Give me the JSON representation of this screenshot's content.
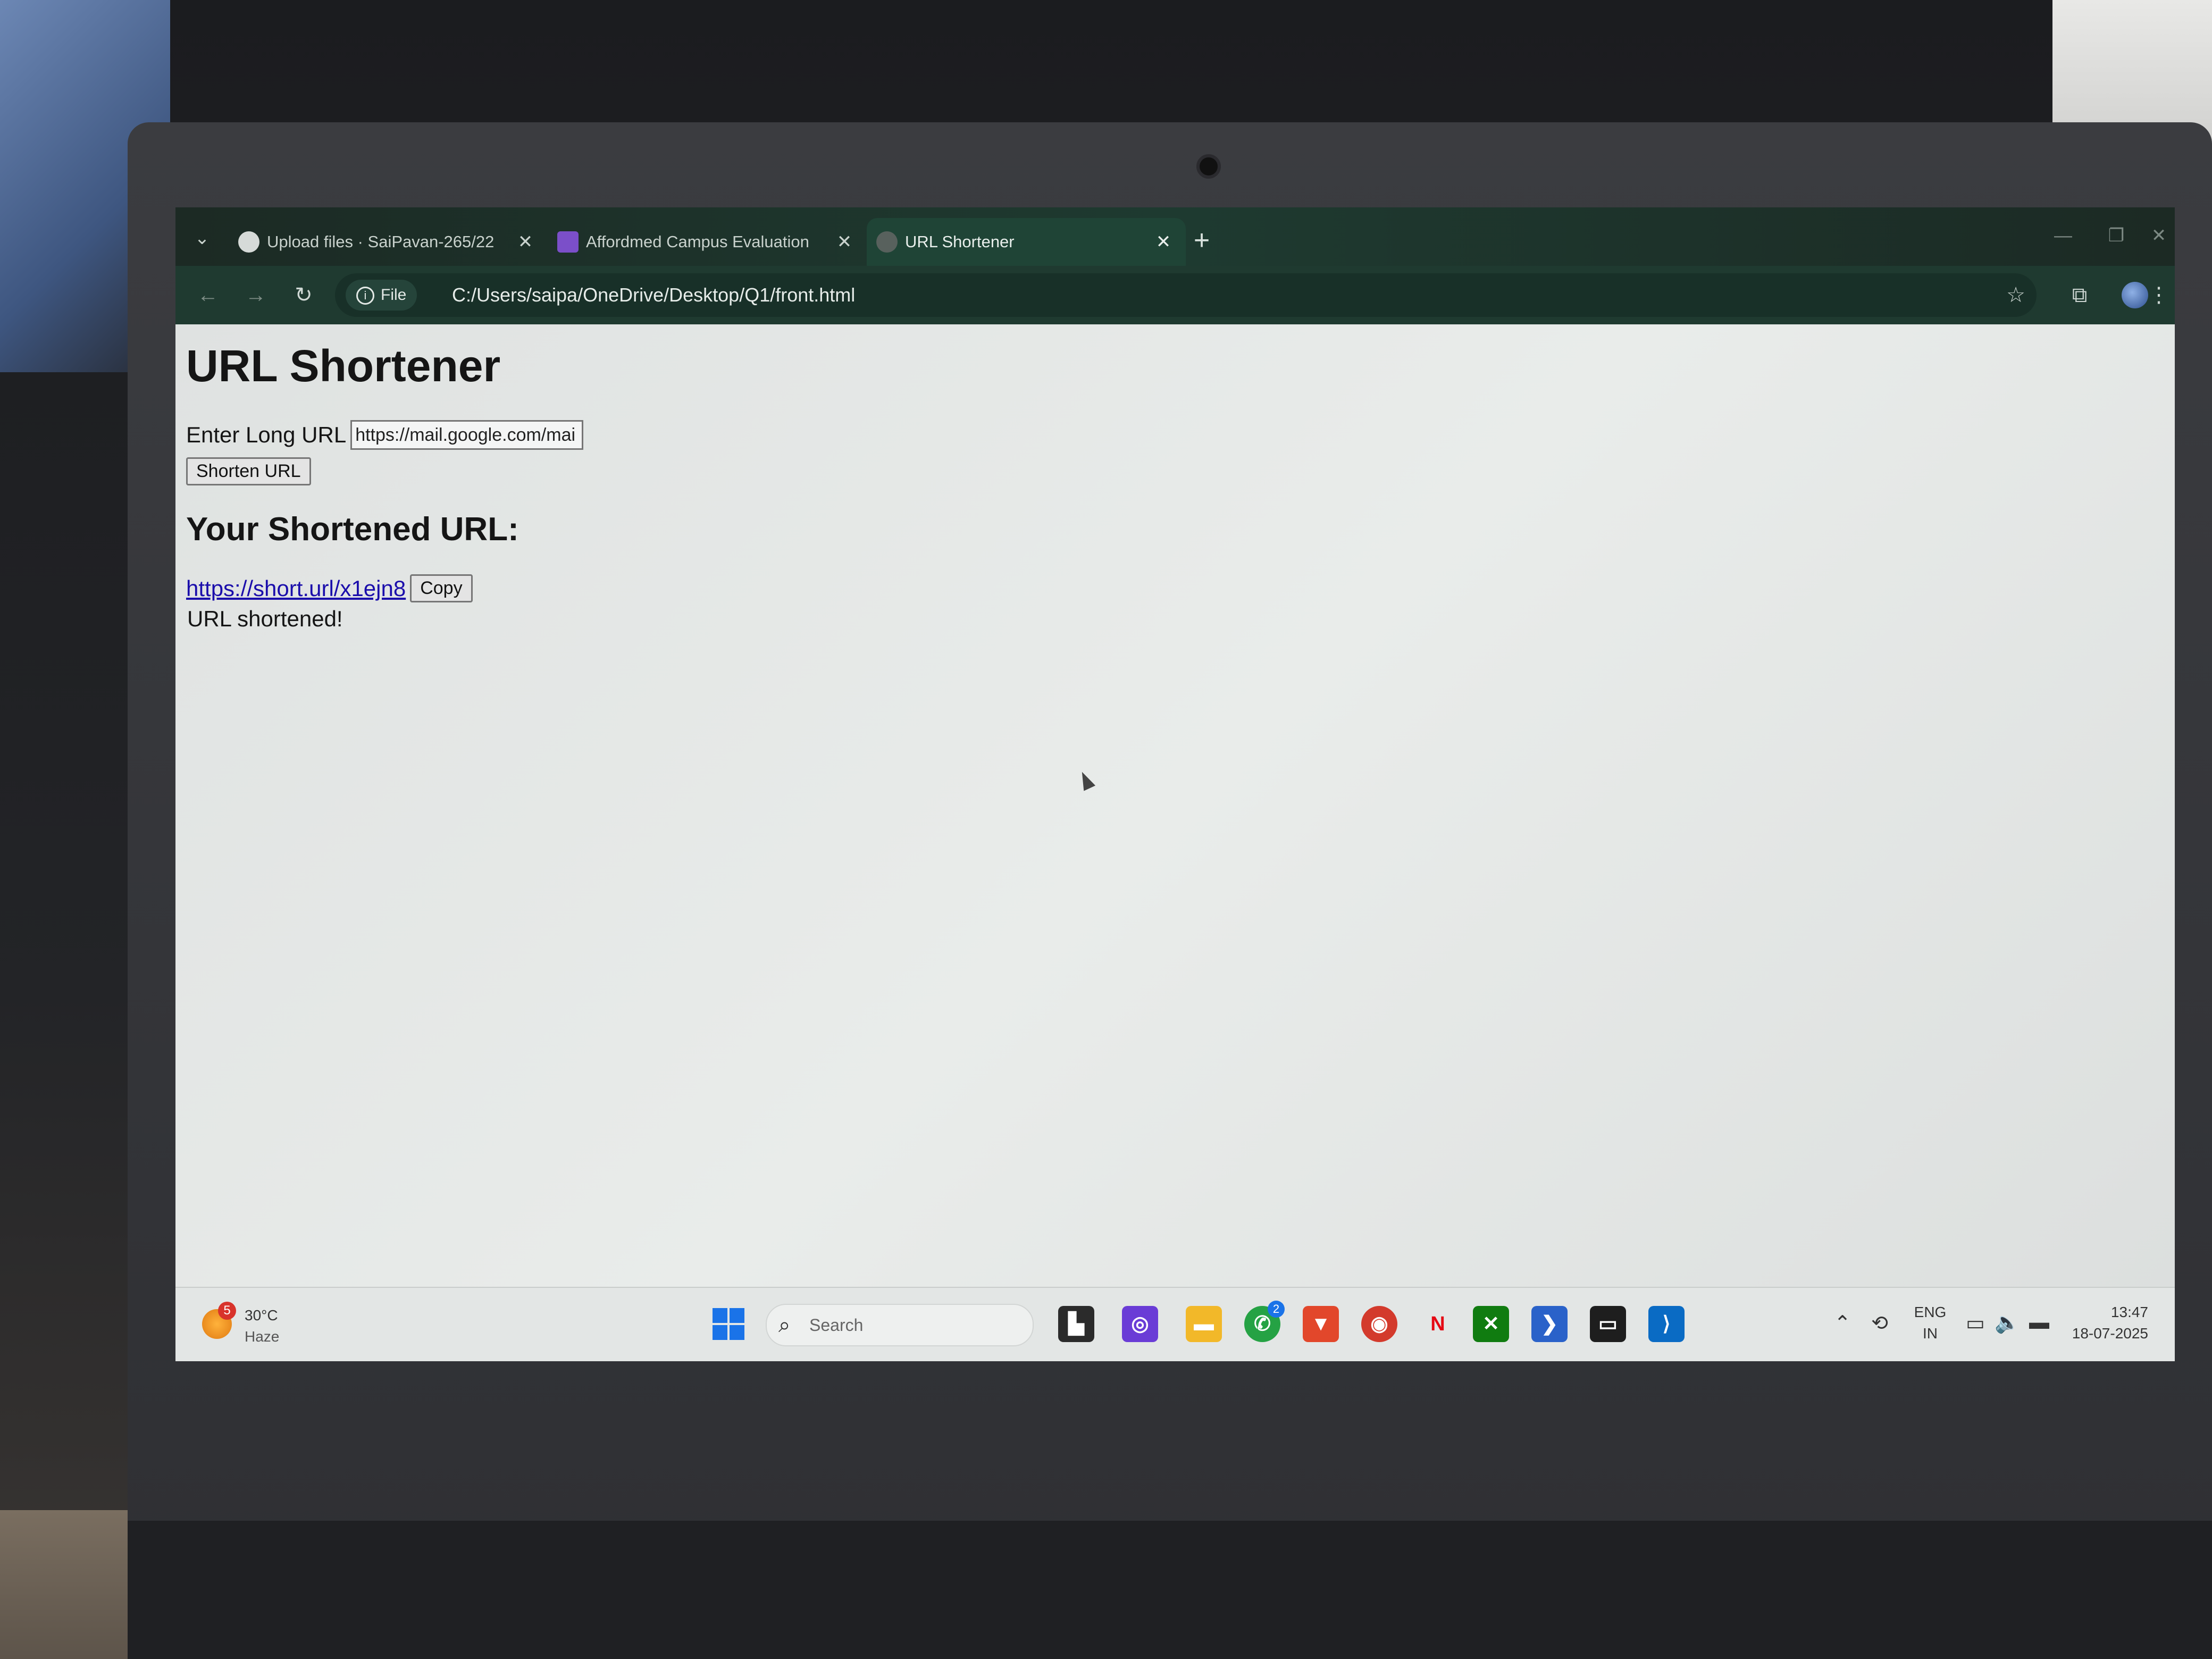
{
  "tabs": [
    {
      "label": "Upload files · SaiPavan-265/22",
      "icon": "github-icon",
      "active": false
    },
    {
      "label": "Affordmed Campus Evaluation",
      "icon": "forms-icon",
      "active": false
    },
    {
      "label": "URL Shortener",
      "icon": "globe-icon",
      "active": true
    }
  ],
  "tab_close": "✕",
  "new_tab": "+",
  "toolbar": {
    "site_info_label": "File",
    "url": "C:/Users/saipa/OneDrive/Desktop/Q1/front.html"
  },
  "page": {
    "title": "URL Shortener",
    "input_label": "Enter Long URL",
    "input_value": "https://mail.google.com/mai",
    "shorten_button": "Shorten URL",
    "result_heading": "Your Shortened URL:",
    "short_url": "https://short.url/x1ejn8",
    "copy_button": "Copy",
    "status": "URL shortened!"
  },
  "taskbar": {
    "weather_badge": "5",
    "temperature": "30°C",
    "condition": "Haze",
    "search_placeholder": "Search",
    "whatsapp_badge": "2",
    "language": "ENG",
    "region": "IN",
    "time": "13:47",
    "date": "18-07-2025"
  },
  "colors": {
    "browser_frame": "#1f3a30",
    "link": "#1a0dab",
    "windows_accent": "#1a73e8"
  }
}
